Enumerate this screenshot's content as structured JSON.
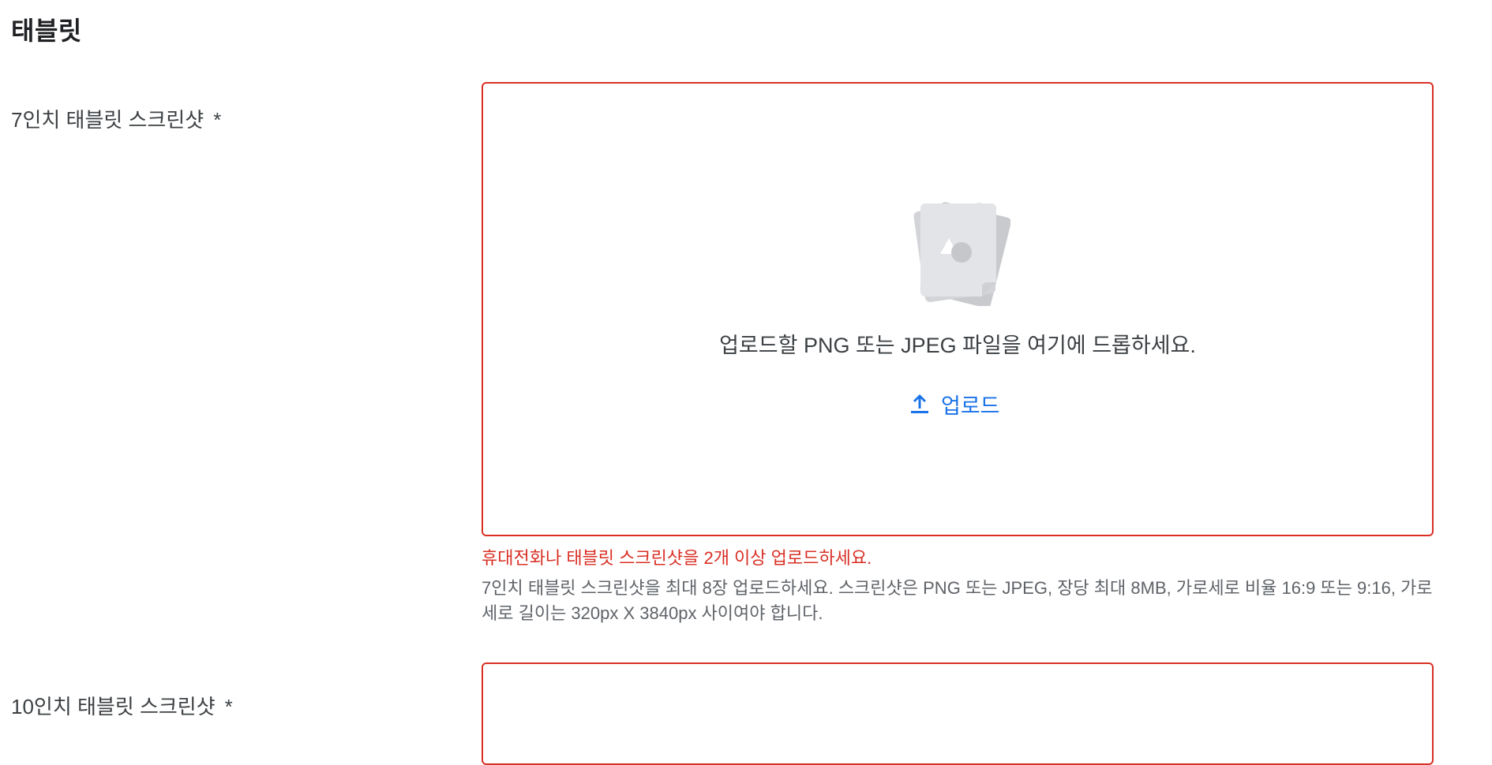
{
  "section": {
    "title": "태블릿"
  },
  "tablet7": {
    "label": "7인치 태블릿 스크린샷",
    "required_mark": "*",
    "dropzone": {
      "icon": "image-files-icon",
      "drop_text": "업로드할 PNG 또는 JPEG 파일을 여기에 드롭하세요.",
      "upload_icon": "upload-icon",
      "upload_label": "업로드"
    },
    "error": "휴대전화나 태블릿 스크린샷을 2개 이상 업로드하세요.",
    "helper": "7인치 태블릿 스크린샷을 최대 8장 업로드하세요. 스크린샷은 PNG 또는 JPEG, 장당 최대 8MB, 가로세로 비율 16:9 또는 9:16, 가로세로 길이는 320px X 3840px 사이여야 합니다."
  },
  "tablet10": {
    "label": "10인치 태블릿 스크린샷",
    "required_mark": "*"
  },
  "colors": {
    "error": "#d93025",
    "accent": "#1a73e8",
    "text": "#3c4043",
    "helper": "#5f6368"
  }
}
